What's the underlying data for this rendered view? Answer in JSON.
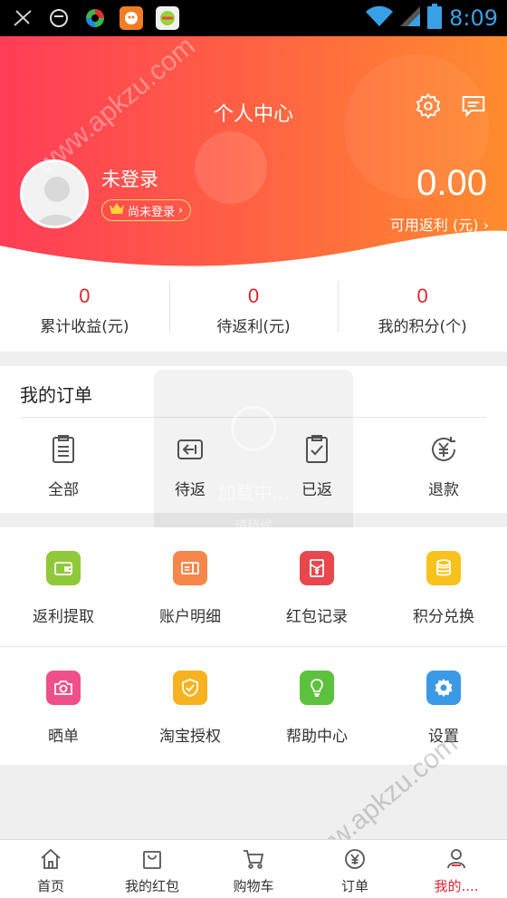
{
  "status_bar": {
    "time": "8:09",
    "icons": [
      "scissors-icon",
      "face-icon",
      "colorful-ball-icon",
      "orange-app-icon",
      "green-app-icon"
    ],
    "right_icons": [
      "wifi-icon",
      "signal-icon",
      "battery-icon"
    ]
  },
  "header": {
    "title": "个人中心",
    "user_name": "未登录",
    "login_badge": "尚未登录",
    "amount": "0.00",
    "amount_label": "可用返利 (元)",
    "gradient": [
      "#ff3d57",
      "#ff8b2e"
    ]
  },
  "stats": [
    {
      "value": "0",
      "label": "累计收益(元)"
    },
    {
      "value": "0",
      "label": "待返利(元)"
    },
    {
      "value": "0",
      "label": "我的积分(个)"
    }
  ],
  "orders": {
    "title": "我的订单",
    "items": [
      {
        "label": "全部",
        "icon": "clipboard-list-icon"
      },
      {
        "label": "待返",
        "icon": "pending-return-icon"
      },
      {
        "label": "已返",
        "icon": "clipboard-check-icon"
      },
      {
        "label": "退款",
        "icon": "refund-yen-icon"
      }
    ]
  },
  "grid": {
    "row1": [
      {
        "label": "返利提取",
        "icon": "wallet-icon",
        "color": "#8fc93a"
      },
      {
        "label": "账户明细",
        "icon": "account-detail-icon",
        "color": "#f7864a"
      },
      {
        "label": "红包记录",
        "icon": "red-envelope-icon",
        "color": "#e8474d"
      },
      {
        "label": "积分兑换",
        "icon": "coins-icon",
        "color": "#f7c21b"
      }
    ],
    "row2": [
      {
        "label": "晒单",
        "icon": "camera-icon",
        "color": "#f0508a"
      },
      {
        "label": "淘宝授权",
        "icon": "shield-check-icon",
        "color": "#f7b31f"
      },
      {
        "label": "帮助中心",
        "icon": "lightbulb-icon",
        "color": "#5cc23d"
      },
      {
        "label": "设置",
        "icon": "gear-icon",
        "color": "#3a9ae6"
      }
    ]
  },
  "tabbar": [
    {
      "label": "首页",
      "icon": "home-icon"
    },
    {
      "label": "我的红包",
      "icon": "bag-icon"
    },
    {
      "label": "购物车",
      "icon": "cart-icon"
    },
    {
      "label": "订单",
      "icon": "yen-circle-icon"
    },
    {
      "label": "我的....",
      "icon": "person-icon",
      "active": true
    }
  ],
  "colors": {
    "accent_red": "#e0262f"
  },
  "watermark": "www.apkzu.com",
  "overlay": {
    "text": "加载中...",
    "sub": "请稍候"
  }
}
